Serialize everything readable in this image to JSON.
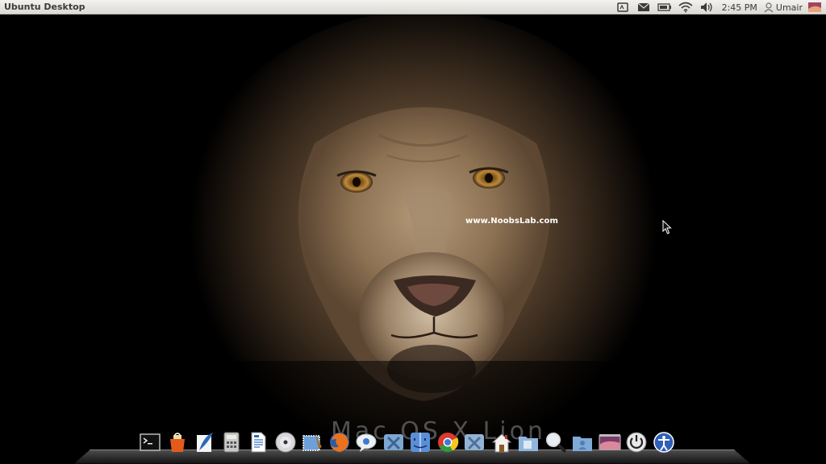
{
  "panel": {
    "title": "Ubuntu Desktop",
    "clock": "2:45 PM",
    "user": "Umair",
    "indicators": [
      "keyboard-icon",
      "mail-icon",
      "battery-icon",
      "wifi-icon",
      "volume-icon"
    ],
    "session_icon": "session-icon"
  },
  "wallpaper": {
    "watermark": "www.NoobsLab.com",
    "dock_backdrop_text": "Mac OS X Lion"
  },
  "dock": {
    "items": [
      "terminal-icon",
      "app-store-bag-icon",
      "quill-writer-icon",
      "calculator-icon",
      "text-document-icon",
      "dvd-disc-icon",
      "mail-stamp-icon",
      "firefox-icon",
      "chat-icon",
      "x11-icon",
      "finder-icon",
      "chrome-icon",
      "x11-alt-icon",
      "home-icon",
      "documents-folder-icon",
      "search-magnifier-icon",
      "user-folder-icon",
      "photo-preview-icon",
      "power-icon",
      "accessibility-icon"
    ]
  },
  "colors": {
    "panel_bg": "#dcdad5",
    "panel_text": "#3c3b37",
    "desktop_bg": "#000000"
  }
}
